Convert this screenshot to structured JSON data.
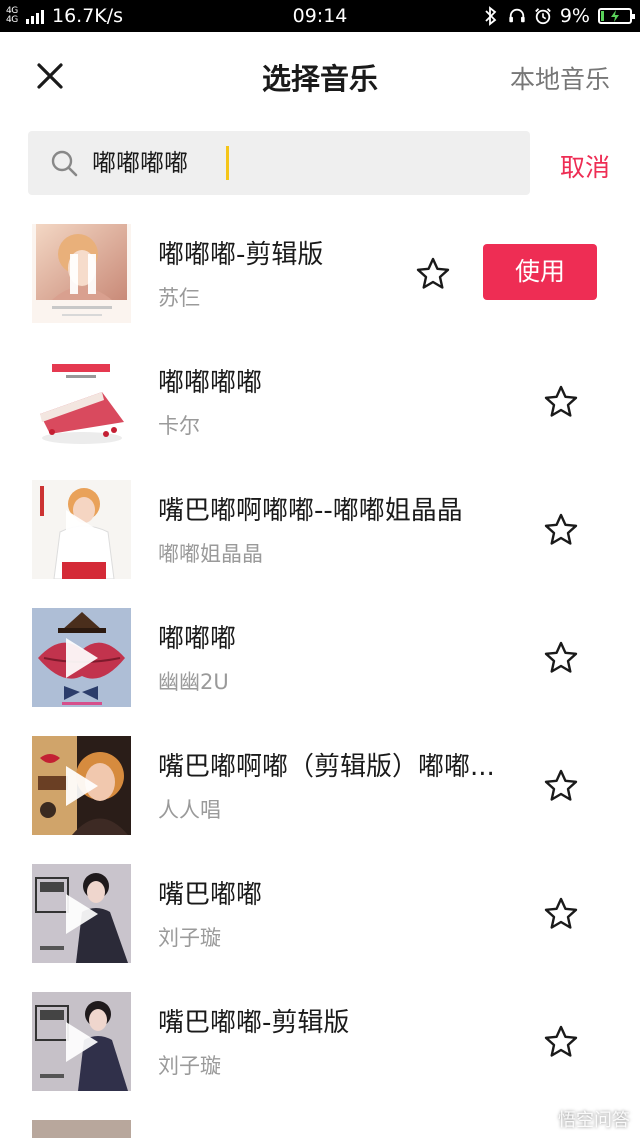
{
  "status_bar": {
    "network": "4G 4G",
    "speed": "16.7K/s",
    "time": "09:14",
    "battery": "9%",
    "icons": [
      "bluetooth-icon",
      "headset-icon",
      "alarm-icon",
      "battery-icon"
    ]
  },
  "header": {
    "title": "选择音乐",
    "local_music": "本地音乐",
    "close_icon": "close-icon"
  },
  "search": {
    "value": "嘟嘟嘟嘟",
    "cancel_label": "取消"
  },
  "colors": {
    "accent": "#ee2d54",
    "caret": "#f5c518",
    "search_bg": "#efefef"
  },
  "songs": [
    {
      "title": "嘟嘟嘟-剪辑版",
      "artist": "苏仨",
      "playing": true,
      "use_label": "使用"
    },
    {
      "title": "嘟嘟嘟嘟",
      "artist": "卡尔"
    },
    {
      "title": "嘴巴嘟啊嘟嘟--嘟嘟姐晶晶",
      "artist": "嘟嘟姐晶晶"
    },
    {
      "title": "嘟嘟嘟",
      "artist": "幽幽2U"
    },
    {
      "title": "嘴巴嘟啊嘟（剪辑版）嘟嘟...",
      "artist": "人人唱"
    },
    {
      "title": "嘴巴嘟嘟",
      "artist": "刘子璇"
    },
    {
      "title": "嘴巴嘟嘟-剪辑版",
      "artist": "刘子璇"
    }
  ],
  "watermark": "悟空问答"
}
